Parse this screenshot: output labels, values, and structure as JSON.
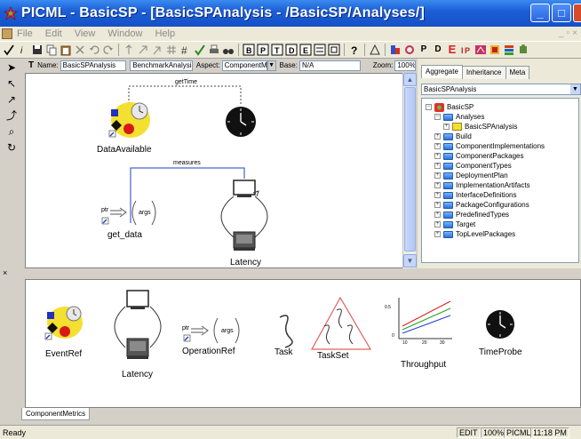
{
  "window": {
    "title": "PICML - BasicSP - [BasicSPAnalysis - /BasicSP/Analyses/]"
  },
  "menu": {
    "items": [
      "File",
      "Edit",
      "View",
      "Window",
      "Help"
    ]
  },
  "editor_header": {
    "name_label": "Name:",
    "name_value": "BasicSPAnalysis",
    "kind_value": "BenchmarkAnalysis",
    "aspect_label": "Aspect:",
    "aspect_value": "ComponentMe",
    "base_label": "Base:",
    "base_value": "N/A",
    "zoom_label": "Zoom:",
    "zoom_value": "100%"
  },
  "canvas": {
    "connection_gettime": "getTime",
    "connection_measures": "measures",
    "data_available_label": "DataAvailable",
    "get_data_label": "get_data",
    "latency_label": "Latency",
    "args_text": "args",
    "ptr_text": "ptr"
  },
  "browser": {
    "tabs": [
      "Aggregate",
      "Inheritance",
      "Meta"
    ],
    "combo_value": "BasicSPAnalysis",
    "tree": [
      {
        "label": "BasicSP",
        "depth": 0,
        "expanded": true,
        "type": "root"
      },
      {
        "label": "Analyses",
        "depth": 1,
        "expanded": true,
        "type": "folder"
      },
      {
        "label": "BasicSPAnalysis",
        "depth": 2,
        "expanded": false,
        "type": "model"
      },
      {
        "label": "Build",
        "depth": 1,
        "expanded": false,
        "type": "folder"
      },
      {
        "label": "ComponentImplementations",
        "depth": 1,
        "expanded": false,
        "type": "folder"
      },
      {
        "label": "ComponentPackages",
        "depth": 1,
        "expanded": false,
        "type": "folder"
      },
      {
        "label": "ComponentTypes",
        "depth": 1,
        "expanded": false,
        "type": "folder"
      },
      {
        "label": "DeploymentPlan",
        "depth": 1,
        "expanded": false,
        "type": "folder"
      },
      {
        "label": "ImplementationArtifacts",
        "depth": 1,
        "expanded": false,
        "type": "folder"
      },
      {
        "label": "InterfaceDefinitions",
        "depth": 1,
        "expanded": false,
        "type": "folder"
      },
      {
        "label": "PackageConfigurations",
        "depth": 1,
        "expanded": false,
        "type": "folder"
      },
      {
        "label": "PredefinedTypes",
        "depth": 1,
        "expanded": false,
        "type": "folder"
      },
      {
        "label": "Target",
        "depth": 1,
        "expanded": false,
        "type": "folder"
      },
      {
        "label": "TopLevelPackages",
        "depth": 1,
        "expanded": false,
        "type": "folder"
      }
    ]
  },
  "parts": {
    "items": [
      "EventRef",
      "Latency",
      "OperationRef",
      "Task",
      "TaskSet",
      "Throughput",
      "TimeProbe"
    ],
    "tab": "ComponentMetrics",
    "throughput_ticks_y": [
      "0.5",
      "0"
    ],
    "throughput_ticks_x": [
      "10",
      "20",
      "30"
    ]
  },
  "status": {
    "ready": "Ready",
    "mode": "EDIT",
    "zoom": "100%",
    "paradigm": "PICML",
    "time": "11:18 PM"
  },
  "colors": {
    "titlebar": "#1c5fd6",
    "canvas_bg": "#ffffff",
    "chrome": "#ece9d8"
  }
}
